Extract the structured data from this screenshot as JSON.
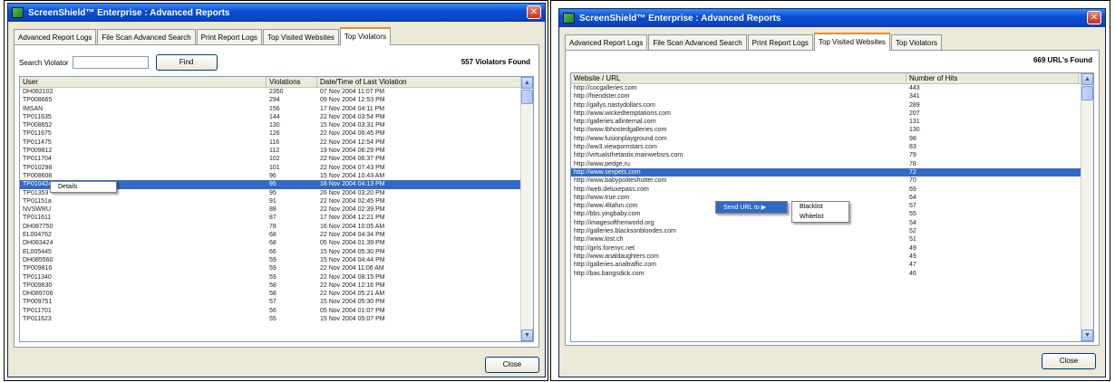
{
  "left_window": {
    "title": "ScreenShield™ Enterprise : Advanced Reports",
    "tabs": [
      "Advanced Report Logs",
      "File Scan Advanced Search",
      "Print Report Logs",
      "Top Visited Websites",
      "Top Violators"
    ],
    "active_tab": "Top Violators",
    "search_label": "Search Violator",
    "search_value": "",
    "find_label": "Find",
    "found_text": "557 Violators Found",
    "columns": [
      "User",
      "Violations",
      "Date/Time of Last Violation"
    ],
    "rows": [
      [
        "DH082102",
        "2350",
        "07 Nov 2004 11:07 PM"
      ],
      [
        "TP008665",
        "294",
        "09 Nov 2004 12:53 PM"
      ],
      [
        "IMSAN",
        "156",
        "17 Nov 2004 04:11 PM"
      ],
      [
        "TP011635",
        "144",
        "22 Nov 2004 03:54 PM"
      ],
      [
        "TP008852",
        "130",
        "15 Nov 2004 03:31 PM"
      ],
      [
        "TP011675",
        "126",
        "22 Nov 2004 06:45 PM"
      ],
      [
        "TP011475",
        "116",
        "22 Nov 2004 12:54 PM"
      ],
      [
        "TP009812",
        "112",
        "19 Nov 2004 06:29 PM"
      ],
      [
        "TP011704",
        "102",
        "22 Nov 2004 06:37 PM"
      ],
      [
        "TP010298",
        "101",
        "22 Nov 2004 07:43 PM"
      ],
      [
        "TP008608",
        "96",
        "15 Nov 2004 10:43 AM"
      ],
      [
        "TP010424",
        "95",
        "16 Nov 2004 04:13 PM"
      ],
      [
        "TP01353",
        "95",
        "26 Nov 2004 03:20 PM"
      ],
      [
        "TP01151a",
        "91",
        "22 Nov 2004 02:45 PM"
      ],
      [
        "NVSWRU",
        "88",
        "22 Nov 2004 02:39 PM"
      ],
      [
        "TP011611",
        "87",
        "17 Nov 2004 12:21 PM"
      ],
      [
        "DH087750",
        "78",
        "16 Nov 2004 10:05 AM"
      ],
      [
        "EL004762",
        "68",
        "22 Nov 2004 04:34 PM"
      ],
      [
        "DH083424",
        "68",
        "05 Nov 2004 01:39 PM"
      ],
      [
        "EL005445",
        "66",
        "15 Nov 2004 05:30 PM"
      ],
      [
        "DH085560",
        "59",
        "15 Nov 2004 04:44 PM"
      ],
      [
        "TP009816",
        "59",
        "22 Nov 2004 11:06 AM"
      ],
      [
        "TP011340",
        "59",
        "22 Nov 2004 08:15 PM"
      ],
      [
        "TP009630",
        "58",
        "22 Nov 2004 12:16 PM"
      ],
      [
        "DH089706",
        "58",
        "22 Nov 2004 05:21 AM"
      ],
      [
        "TP009751",
        "57",
        "15 Nov 2004 05:30 PM"
      ],
      [
        "TP011701",
        "56",
        "05 Nov 2004 01:07 PM"
      ],
      [
        "TP011623",
        "55",
        "15 Nov 2004 05:07 PM"
      ]
    ],
    "selected_row": 11,
    "context_menu": [
      "Details"
    ],
    "close_label": "Close"
  },
  "right_window": {
    "title": "ScreenShield™ Enterprise : Advanced Reports",
    "tabs": [
      "Advanced Report Logs",
      "File Scan Advanced Search",
      "Print Report Logs",
      "Top Visited Websites",
      "Top Violators"
    ],
    "active_tab": "Top Visited Websites",
    "found_text": "669 URL's Found",
    "columns": [
      "Website / URL",
      "Number of Hits"
    ],
    "rows": [
      [
        "http://cocgalleries.com",
        "443"
      ],
      [
        "http://friendster.com",
        "341"
      ],
      [
        "http://gallys.nastydollars.com",
        "289"
      ],
      [
        "http://www.wickedtemptations.com",
        "207"
      ],
      [
        "http://galleries.allinternal.com",
        "131"
      ],
      [
        "http://www.tbhostedgalleries.com",
        "130"
      ],
      [
        "http://www.fusionplayground.com",
        "98"
      ],
      [
        "http://ww3.viewpornstars.com",
        "83"
      ],
      [
        "http://virtualsthetastix.mainwebsrs.com",
        "79"
      ],
      [
        "http://www.pedge.ru",
        "78"
      ],
      [
        "http://www.sexpets.com",
        "72"
      ],
      [
        "http://www.babypoliteshutter.com",
        "70"
      ],
      [
        "http://web.deluxepass.com",
        "69"
      ],
      [
        "http://www.true.com",
        "64"
      ],
      [
        "http://www.4ltafun.com",
        "57"
      ],
      [
        "http://bbs.yingbaby.com",
        "55"
      ],
      [
        "http://imagesofthenworld.org",
        "54"
      ],
      [
        "http://galleries.blacksonblondes.com",
        "52"
      ],
      [
        "http://www.lost.ch",
        "51"
      ],
      [
        "http://girls.forenyc.net",
        "49"
      ],
      [
        "http://www.analdaughters.com",
        "49"
      ],
      [
        "http://galleries.analtraffic.com",
        "47"
      ],
      [
        "http://bas.bangsdick.com",
        "46"
      ]
    ],
    "selected_row": 10,
    "context_menu": [
      "Send URL to",
      "Blacklist",
      "Whitelist"
    ],
    "close_label": "Close"
  }
}
